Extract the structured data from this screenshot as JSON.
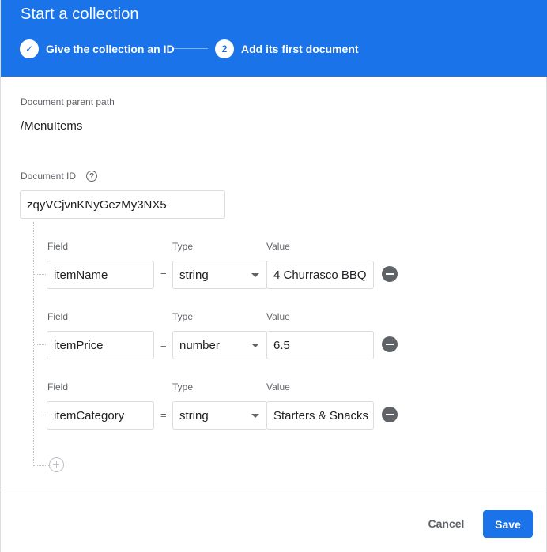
{
  "dialog": {
    "title": "Start a collection",
    "steps": [
      {
        "number": "✓",
        "label": "Give the collection an ID",
        "state": "complete"
      },
      {
        "number": "2",
        "label": "Add its first document",
        "state": "active"
      }
    ]
  },
  "document": {
    "parent_path_label": "Document parent path",
    "parent_path": "/MenuItems",
    "id_label": "Document ID",
    "id_value": "zqyVCjvnKNyGezMy3NX5"
  },
  "fields": [
    {
      "field_label": "Field",
      "type_label": "Type",
      "value_label": "Value",
      "name": "itemName",
      "equals": "=",
      "type": "string",
      "value": "4 Churrasco BBQ"
    },
    {
      "field_label": "Field",
      "type_label": "Type",
      "value_label": "Value",
      "name": "itemPrice",
      "equals": "=",
      "type": "number",
      "value": "6.5"
    },
    {
      "field_label": "Field",
      "type_label": "Type",
      "value_label": "Value",
      "name": "itemCategory",
      "equals": "=",
      "type": "string",
      "value": "Starters & Snacks"
    }
  ],
  "footer": {
    "cancel_label": "Cancel",
    "save_label": "Save"
  },
  "colors": {
    "accent": "#1a73e8",
    "icon_gray": "#5f6368",
    "border": "#dadce0"
  },
  "icons": {
    "help": "help-circle-icon",
    "remove": "remove-circle-icon",
    "add": "add-circle-icon",
    "caret": "chevron-down-icon",
    "check": "check-icon"
  }
}
